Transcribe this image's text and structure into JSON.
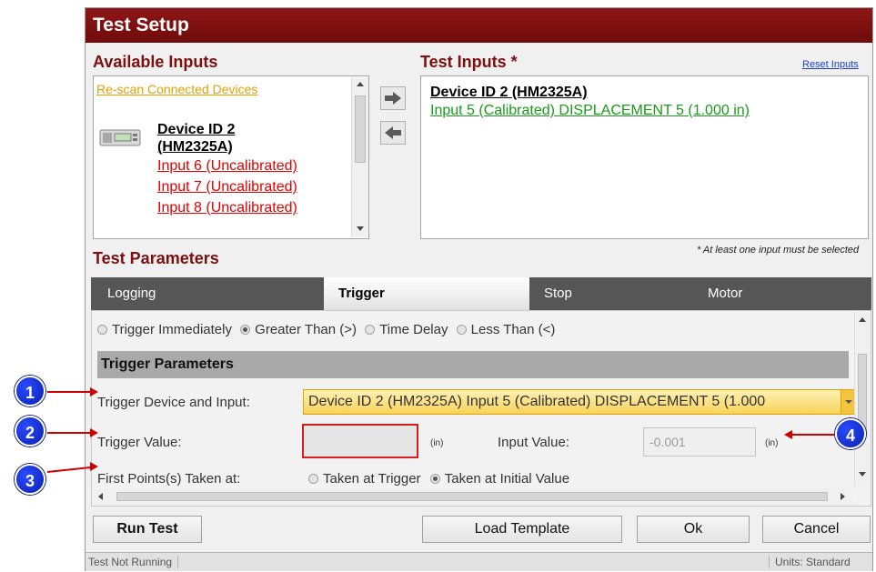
{
  "window": {
    "title": "Test Setup"
  },
  "available_inputs": {
    "title": "Available Inputs",
    "rescan_link": "Re-scan Connected Devices",
    "device_name_line1": "Device ID 2",
    "device_name_line2": "(HM2325A)",
    "inputs": [
      "Input 6 (Uncalibrated)",
      "Input 7 (Uncalibrated)",
      "Input 8 (Uncalibrated)"
    ]
  },
  "test_inputs": {
    "title": "Test Inputs *",
    "reset_link": "Reset Inputs",
    "device_name": "Device ID 2 (HM2325A)",
    "selected_input": "Input 5 (Calibrated) DISPLACEMENT 5 (1.000 in)",
    "note": "* At least one input must be selected"
  },
  "test_parameters": {
    "title": "Test Parameters",
    "tabs": [
      "Logging",
      "Trigger",
      "Stop",
      "Motor"
    ],
    "active_tab": "Trigger",
    "trigger_modes": [
      "Trigger Immediately",
      "Greater Than (>)",
      "Time Delay",
      "Less Than (<)"
    ],
    "selected_trigger_mode": "Greater Than (>)",
    "group_title": "Trigger Parameters",
    "trigger_device_label": "Trigger Device and Input:",
    "trigger_device_value": "Device ID 2 (HM2325A) Input 5 (Calibrated) DISPLACEMENT 5 (1.000",
    "trigger_value_label": "Trigger Value:",
    "trigger_value": "",
    "trigger_value_unit": "(in)",
    "input_value_label": "Input Value:",
    "input_value": "-0.001",
    "input_value_unit": "(in)",
    "first_points_label": "First Points(s) Taken at:",
    "first_points_options": [
      "Taken at Trigger",
      "Taken at Initial Value"
    ],
    "first_points_selected": "Taken at Initial Value"
  },
  "buttons": {
    "run_test": "Run Test",
    "load_template": "Load Template",
    "ok": "Ok",
    "cancel": "Cancel"
  },
  "status": {
    "left": "Test Not Running",
    "right": "Units: Standard"
  },
  "callouts": [
    "1",
    "2",
    "3",
    "4"
  ],
  "colors": {
    "title_bar": "#7a1010",
    "callout": "#1030d0",
    "highlight_red": "#d00000",
    "link_green": "#1a9a1a",
    "link_red": "#e60000"
  }
}
